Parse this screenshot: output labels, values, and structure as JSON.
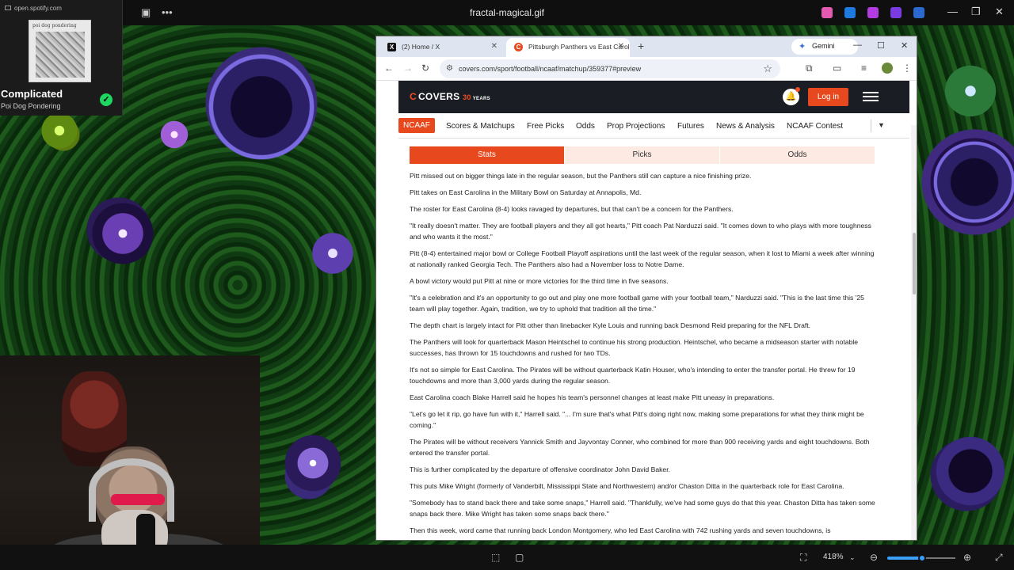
{
  "viewer": {
    "file_title": "fractal-magical.gif",
    "zoom_level": "418%",
    "zoom_fraction": 0.52
  },
  "spotify": {
    "origin": "open.spotify.com",
    "art_text": "poi dog pondering",
    "song": "Complicated",
    "artist": "Poi Dog Pondering"
  },
  "browser": {
    "tabs": [
      {
        "label": "(2) Home / X",
        "icon": "x-logo-icon"
      },
      {
        "label": "Pittsburgh Panthers vs East Carolina",
        "icon": "covers-logo-icon"
      }
    ],
    "gemini_label": "Gemini",
    "url": "covers.com/sport/football/ncaaf/matchup/359377#preview"
  },
  "site": {
    "logo_text": "COVERS",
    "logo_years_num": "30",
    "logo_years_word": "YEARS",
    "login_label": "Log in",
    "accent": "#e8481d",
    "subnav": [
      "NCAAF",
      "Scores & Matchups",
      "Free Picks",
      "Odds",
      "Prop Projections",
      "Futures",
      "News & Analysis",
      "NCAAF Contest"
    ],
    "pill_tabs": [
      "Stats",
      "Picks",
      "Odds"
    ]
  },
  "article": {
    "paragraphs": [
      "Pitt missed out on bigger things late in the regular season, but the Panthers still can capture a nice finishing prize.",
      "Pitt takes on East Carolina in the Military Bowl on Saturday at Annapolis, Md.",
      "The roster for East Carolina (8-4) looks ravaged by departures, but that can't be a concern for the Panthers.",
      "\"It really doesn't matter. They are football players and they all got hearts,\" Pitt coach Pat Narduzzi said. \"It comes down to who plays with more toughness and who wants it the most.\"",
      "Pitt (8-4) entertained major bowl or College Football Playoff aspirations until the last week of the regular season, when it lost to Miami a week after winning at nationally ranked Georgia Tech. The Panthers also had a November loss to Notre Dame.",
      "A bowl victory would put Pitt at nine or more victories for the third time in five seasons.",
      "\"It's a celebration and it's an opportunity to go out and play one more football game with your football team,\" Narduzzi said. \"This is the last time this '25 team will play together. Again, tradition, we try to uphold that tradition all the time.\"",
      "The depth chart is largely intact for Pitt other than linebacker Kyle Louis and running back Desmond Reid preparing for the NFL Draft.",
      "The Panthers will look for quarterback Mason Heintschel to continue his strong production. Heintschel, who became a midseason starter with notable successes, has thrown for 15 touchdowns and rushed for two TDs.",
      "It's not so simple for East Carolina. The Pirates will be without quarterback Katin Houser, who's intending to enter the transfer portal. He threw for 19 touchdowns and more than 3,000 yards during the regular season.",
      "East Carolina coach Blake Harrell said he hopes his team's personnel changes at least make Pitt uneasy in preparations.",
      "\"Let's go let it rip, go have fun with it,\" Harrell said. \"... I'm sure that's what Pitt's doing right now, making some preparations for what they think might be coming.\"",
      "The Pirates will be without receivers Yannick Smith and Jayvontay Conner, who combined for more than 900 receiving yards and eight touchdowns. Both entered the transfer portal.",
      "This is further complicated by the departure of offensive coordinator John David Baker.",
      "This puts Mike Wright (formerly of Vanderbilt, Mississippi State and Northwestern) and/or Chaston Ditta in the quarterback role for East Carolina.",
      "\"Somebody has to stand back there and take some snaps,\" Harrell said. \"Thankfully, we've had some guys do that this year. Chaston Ditta has taken some snaps back there. Mike Wright has taken some snaps back there.\"",
      "Then this week, word came that running back London Montgomery, who led East Carolina with 742 rushing yards and seven touchdowns, is"
    ]
  }
}
